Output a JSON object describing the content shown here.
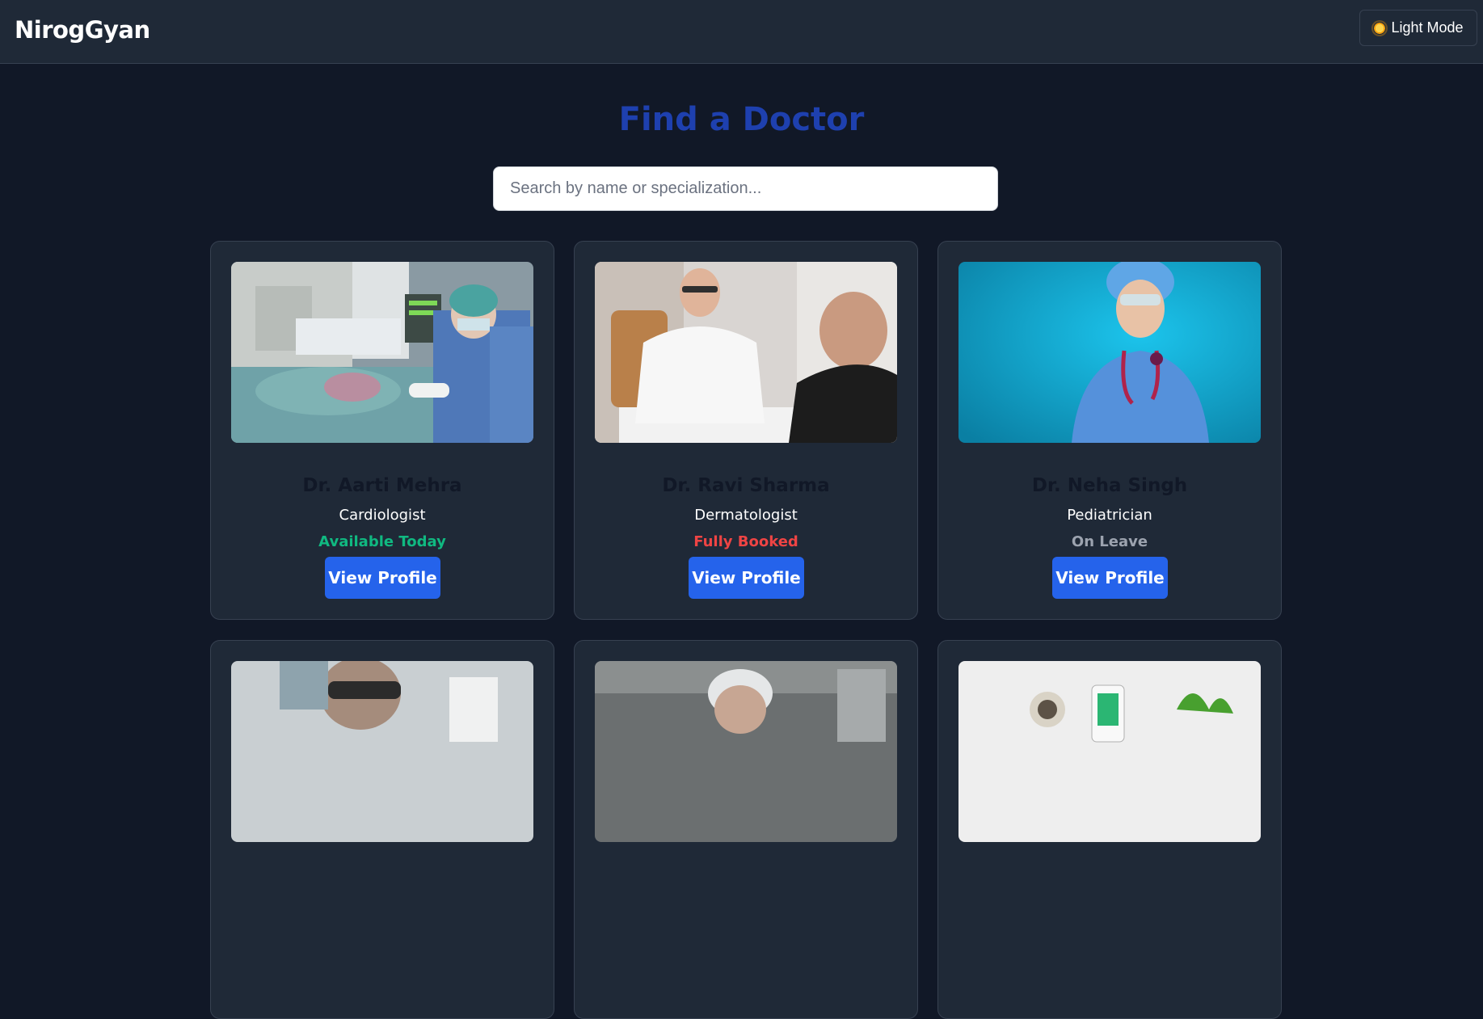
{
  "navbar": {
    "brand": "NirogGyan",
    "mode_toggle": {
      "icon": "sun-icon",
      "label": "Light Mode"
    }
  },
  "main": {
    "title": "Find a Doctor",
    "search": {
      "placeholder": "Search by name or specialization...",
      "value": ""
    }
  },
  "colors": {
    "available": "#10b981",
    "booked": "#ef4444",
    "leave": "#9ca3af",
    "primary_button": "#2563eb",
    "title": "#1e40af"
  },
  "doctors": [
    {
      "name": "Dr. Aarti Mehra",
      "specialization": "Cardiologist",
      "status": "Available Today",
      "status_type": "available",
      "button": "View Profile",
      "photo": "surgery-team-photo"
    },
    {
      "name": "Dr. Ravi Sharma",
      "specialization": "Dermatologist",
      "status": "Fully Booked",
      "status_type": "booked",
      "button": "View Profile",
      "photo": "doctor-consultation-photo"
    },
    {
      "name": "Dr. Neha Singh",
      "specialization": "Pediatrician",
      "status": "On Leave",
      "status_type": "leave",
      "button": "View Profile",
      "photo": "doctor-stethoscope-photo"
    },
    {
      "photo": "lab-technician-photo"
    },
    {
      "photo": "scientist-hairnet-photo"
    },
    {
      "photo": "medical-products-photo"
    }
  ]
}
